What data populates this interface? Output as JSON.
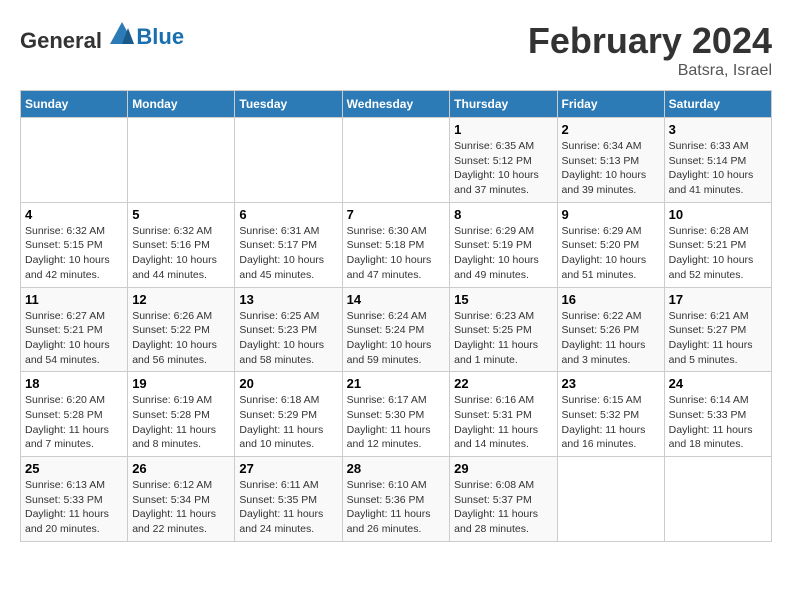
{
  "header": {
    "logo_general": "General",
    "logo_blue": "Blue",
    "title": "February 2024",
    "subtitle": "Batsra, Israel"
  },
  "weekdays": [
    "Sunday",
    "Monday",
    "Tuesday",
    "Wednesday",
    "Thursday",
    "Friday",
    "Saturday"
  ],
  "weeks": [
    [
      {
        "day": "",
        "sunrise": "",
        "sunset": "",
        "daylight": ""
      },
      {
        "day": "",
        "sunrise": "",
        "sunset": "",
        "daylight": ""
      },
      {
        "day": "",
        "sunrise": "",
        "sunset": "",
        "daylight": ""
      },
      {
        "day": "",
        "sunrise": "",
        "sunset": "",
        "daylight": ""
      },
      {
        "day": "1",
        "sunrise": "Sunrise: 6:35 AM",
        "sunset": "Sunset: 5:12 PM",
        "daylight": "Daylight: 10 hours and 37 minutes."
      },
      {
        "day": "2",
        "sunrise": "Sunrise: 6:34 AM",
        "sunset": "Sunset: 5:13 PM",
        "daylight": "Daylight: 10 hours and 39 minutes."
      },
      {
        "day": "3",
        "sunrise": "Sunrise: 6:33 AM",
        "sunset": "Sunset: 5:14 PM",
        "daylight": "Daylight: 10 hours and 41 minutes."
      }
    ],
    [
      {
        "day": "4",
        "sunrise": "Sunrise: 6:32 AM",
        "sunset": "Sunset: 5:15 PM",
        "daylight": "Daylight: 10 hours and 42 minutes."
      },
      {
        "day": "5",
        "sunrise": "Sunrise: 6:32 AM",
        "sunset": "Sunset: 5:16 PM",
        "daylight": "Daylight: 10 hours and 44 minutes."
      },
      {
        "day": "6",
        "sunrise": "Sunrise: 6:31 AM",
        "sunset": "Sunset: 5:17 PM",
        "daylight": "Daylight: 10 hours and 45 minutes."
      },
      {
        "day": "7",
        "sunrise": "Sunrise: 6:30 AM",
        "sunset": "Sunset: 5:18 PM",
        "daylight": "Daylight: 10 hours and 47 minutes."
      },
      {
        "day": "8",
        "sunrise": "Sunrise: 6:29 AM",
        "sunset": "Sunset: 5:19 PM",
        "daylight": "Daylight: 10 hours and 49 minutes."
      },
      {
        "day": "9",
        "sunrise": "Sunrise: 6:29 AM",
        "sunset": "Sunset: 5:20 PM",
        "daylight": "Daylight: 10 hours and 51 minutes."
      },
      {
        "day": "10",
        "sunrise": "Sunrise: 6:28 AM",
        "sunset": "Sunset: 5:21 PM",
        "daylight": "Daylight: 10 hours and 52 minutes."
      }
    ],
    [
      {
        "day": "11",
        "sunrise": "Sunrise: 6:27 AM",
        "sunset": "Sunset: 5:21 PM",
        "daylight": "Daylight: 10 hours and 54 minutes."
      },
      {
        "day": "12",
        "sunrise": "Sunrise: 6:26 AM",
        "sunset": "Sunset: 5:22 PM",
        "daylight": "Daylight: 10 hours and 56 minutes."
      },
      {
        "day": "13",
        "sunrise": "Sunrise: 6:25 AM",
        "sunset": "Sunset: 5:23 PM",
        "daylight": "Daylight: 10 hours and 58 minutes."
      },
      {
        "day": "14",
        "sunrise": "Sunrise: 6:24 AM",
        "sunset": "Sunset: 5:24 PM",
        "daylight": "Daylight: 10 hours and 59 minutes."
      },
      {
        "day": "15",
        "sunrise": "Sunrise: 6:23 AM",
        "sunset": "Sunset: 5:25 PM",
        "daylight": "Daylight: 11 hours and 1 minute."
      },
      {
        "day": "16",
        "sunrise": "Sunrise: 6:22 AM",
        "sunset": "Sunset: 5:26 PM",
        "daylight": "Daylight: 11 hours and 3 minutes."
      },
      {
        "day": "17",
        "sunrise": "Sunrise: 6:21 AM",
        "sunset": "Sunset: 5:27 PM",
        "daylight": "Daylight: 11 hours and 5 minutes."
      }
    ],
    [
      {
        "day": "18",
        "sunrise": "Sunrise: 6:20 AM",
        "sunset": "Sunset: 5:28 PM",
        "daylight": "Daylight: 11 hours and 7 minutes."
      },
      {
        "day": "19",
        "sunrise": "Sunrise: 6:19 AM",
        "sunset": "Sunset: 5:28 PM",
        "daylight": "Daylight: 11 hours and 8 minutes."
      },
      {
        "day": "20",
        "sunrise": "Sunrise: 6:18 AM",
        "sunset": "Sunset: 5:29 PM",
        "daylight": "Daylight: 11 hours and 10 minutes."
      },
      {
        "day": "21",
        "sunrise": "Sunrise: 6:17 AM",
        "sunset": "Sunset: 5:30 PM",
        "daylight": "Daylight: 11 hours and 12 minutes."
      },
      {
        "day": "22",
        "sunrise": "Sunrise: 6:16 AM",
        "sunset": "Sunset: 5:31 PM",
        "daylight": "Daylight: 11 hours and 14 minutes."
      },
      {
        "day": "23",
        "sunrise": "Sunrise: 6:15 AM",
        "sunset": "Sunset: 5:32 PM",
        "daylight": "Daylight: 11 hours and 16 minutes."
      },
      {
        "day": "24",
        "sunrise": "Sunrise: 6:14 AM",
        "sunset": "Sunset: 5:33 PM",
        "daylight": "Daylight: 11 hours and 18 minutes."
      }
    ],
    [
      {
        "day": "25",
        "sunrise": "Sunrise: 6:13 AM",
        "sunset": "Sunset: 5:33 PM",
        "daylight": "Daylight: 11 hours and 20 minutes."
      },
      {
        "day": "26",
        "sunrise": "Sunrise: 6:12 AM",
        "sunset": "Sunset: 5:34 PM",
        "daylight": "Daylight: 11 hours and 22 minutes."
      },
      {
        "day": "27",
        "sunrise": "Sunrise: 6:11 AM",
        "sunset": "Sunset: 5:35 PM",
        "daylight": "Daylight: 11 hours and 24 minutes."
      },
      {
        "day": "28",
        "sunrise": "Sunrise: 6:10 AM",
        "sunset": "Sunset: 5:36 PM",
        "daylight": "Daylight: 11 hours and 26 minutes."
      },
      {
        "day": "29",
        "sunrise": "Sunrise: 6:08 AM",
        "sunset": "Sunset: 5:37 PM",
        "daylight": "Daylight: 11 hours and 28 minutes."
      },
      {
        "day": "",
        "sunrise": "",
        "sunset": "",
        "daylight": ""
      },
      {
        "day": "",
        "sunrise": "",
        "sunset": "",
        "daylight": ""
      }
    ]
  ]
}
